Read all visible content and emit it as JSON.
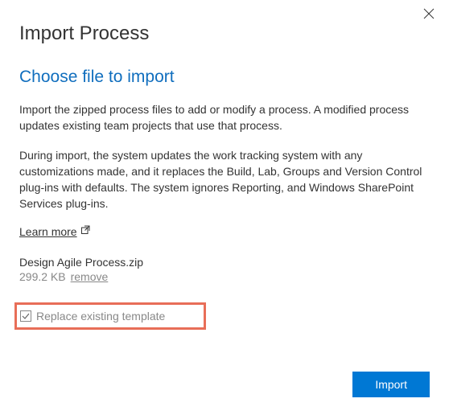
{
  "dialog": {
    "title": "Import Process",
    "subtitle": "Choose file to import",
    "paragraph1": "Import the zipped process files to add or modify a process. A modified process updates existing team projects that use that process.",
    "paragraph2": "During import, the system updates the work tracking system with any customizations made, and it replaces the Build, Lab, Groups and Version Control plug-ins with defaults. The system ignores Reporting, and Windows SharePoint Services plug-ins.",
    "learn_more_label": "Learn more"
  },
  "file": {
    "name": "Design Agile Process.zip",
    "size": "299.2 KB",
    "remove_label": "remove"
  },
  "checkbox": {
    "label": "Replace existing template",
    "checked": true
  },
  "actions": {
    "import_label": "Import"
  }
}
